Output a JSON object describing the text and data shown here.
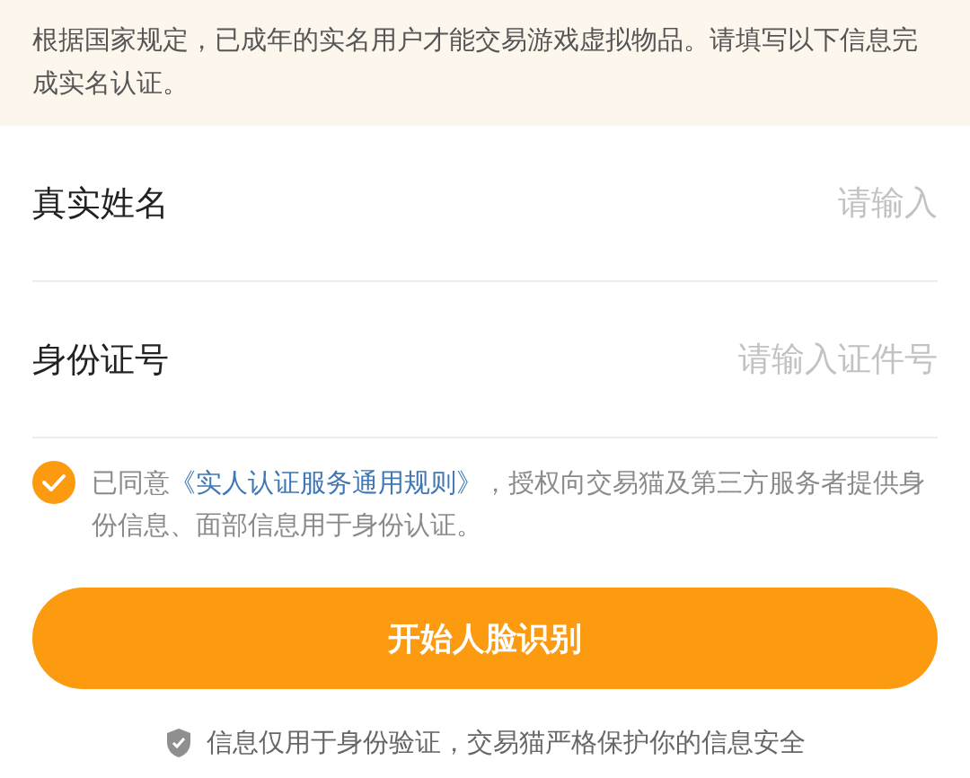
{
  "notice": "根据国家规定，已成年的实名用户才能交易游戏虚拟物品。请填写以下信息完成实名认证。",
  "fields": [
    {
      "label": "真实姓名",
      "placeholder": "请输入"
    },
    {
      "label": "身份证号",
      "placeholder": "请输入证件号"
    }
  ],
  "agreement": {
    "checked": true,
    "prefix": "已同意",
    "link": "《实人认证服务通用规则》",
    "suffix": "，授权向交易猫及第三方服务者提供身份信息、面部信息用于身份认证。"
  },
  "button": "开始人脸识别",
  "footer": "信息仅用于身份验证，交易猫严格保护你的信息安全"
}
